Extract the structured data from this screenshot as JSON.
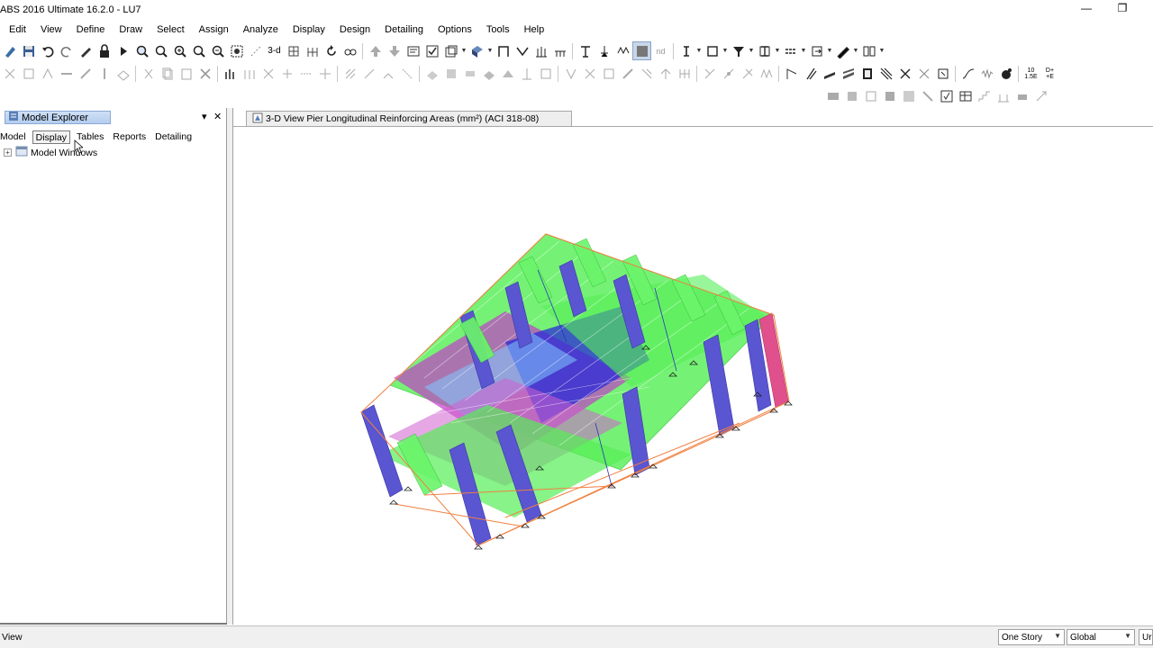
{
  "window": {
    "title": "ABS 2016 Ultimate 16.2.0 - LU7",
    "minimize_glyph": "—",
    "restore_glyph": "❐"
  },
  "menu": [
    "Edit",
    "View",
    "Define",
    "Draw",
    "Select",
    "Assign",
    "Analyze",
    "Display",
    "Design",
    "Detailing",
    "Options",
    "Tools",
    "Help"
  ],
  "toolbar": {
    "label_3d": "3-d",
    "label_nd": "nd",
    "label_ve_top": "10",
    "label_ve_bottom": "1.5E",
    "label_dv_top": "D+",
    "label_dv_bottom": "+E"
  },
  "explorer": {
    "title": "Model Explorer",
    "pin_glyph": "▾",
    "close_glyph": "✕",
    "tabs": [
      "Model",
      "Display",
      "Tables",
      "Reports",
      "Detailing"
    ],
    "active_tab": "Display",
    "tree": [
      {
        "label": "Model Windows",
        "expander": "+"
      }
    ]
  },
  "view": {
    "tab_title": "3-D View  Pier Longitudinal Reinforcing Areas (mm²)  (ACI 318-08)",
    "close_glyph": "✕"
  },
  "status": {
    "text": "View",
    "story_select": "One Story",
    "coord_select": "Global",
    "units_button": "Ur"
  },
  "colors": {
    "slab_green": "#4cf04c",
    "wall_magenta": "#c040c0",
    "wall_purple": "#5050cc",
    "wall_blue": "#2a2ad8",
    "wall_pink": "#e0508c",
    "beam_orange": "#f08040",
    "accent_blue": "#b4cdef"
  }
}
